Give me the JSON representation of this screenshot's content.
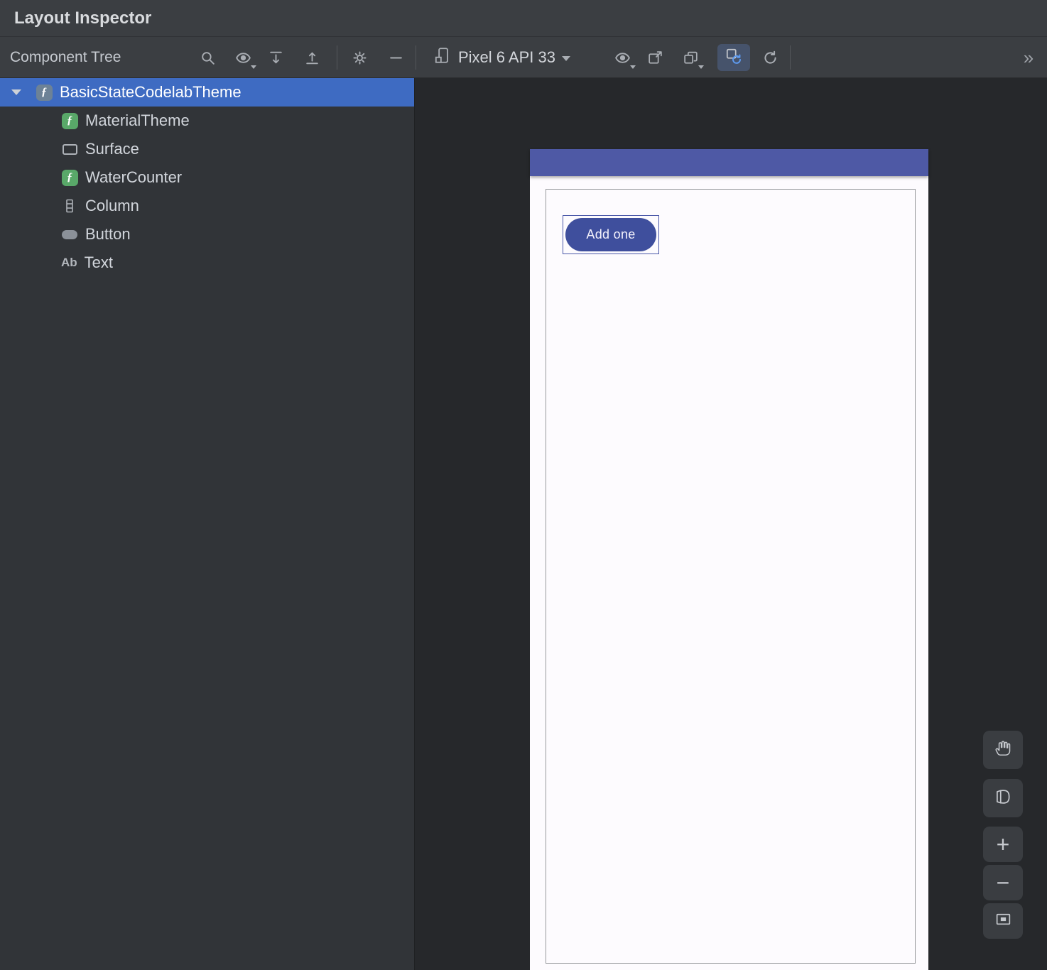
{
  "window": {
    "title": "Layout Inspector"
  },
  "tree_toolbar": {
    "title": "Component Tree"
  },
  "main_toolbar": {
    "process_selector": "Pixel 6 API 33",
    "overflow_glyph": "»"
  },
  "tree": {
    "items": [
      {
        "label": "BasicStateCodelabTheme",
        "icon": "compose-theme",
        "selected": true,
        "expanded": true
      },
      {
        "label": "MaterialTheme",
        "icon": "compose-function",
        "selected": false
      },
      {
        "label": "Surface",
        "icon": "surface",
        "selected": false
      },
      {
        "label": "WaterCounter",
        "icon": "compose-function",
        "selected": false
      },
      {
        "label": "Column",
        "icon": "column",
        "selected": false
      },
      {
        "label": "Button",
        "icon": "button",
        "selected": false
      },
      {
        "label": "Text",
        "icon": "text",
        "icon_glyph": "Ab",
        "selected": false
      }
    ]
  },
  "device_render": {
    "app_button_label": "Add one"
  },
  "canvas_controls": {
    "zoom_in_glyph": "+",
    "zoom_out_glyph": "−"
  },
  "colors": {
    "tree_selection": "#3E6BC2",
    "device_app_bar": "#4E59A5",
    "device_button": "#3F4F9D",
    "toolbar_toggle_active_bg": "#46536B",
    "live_updates_accent": "#5E9BF0"
  }
}
